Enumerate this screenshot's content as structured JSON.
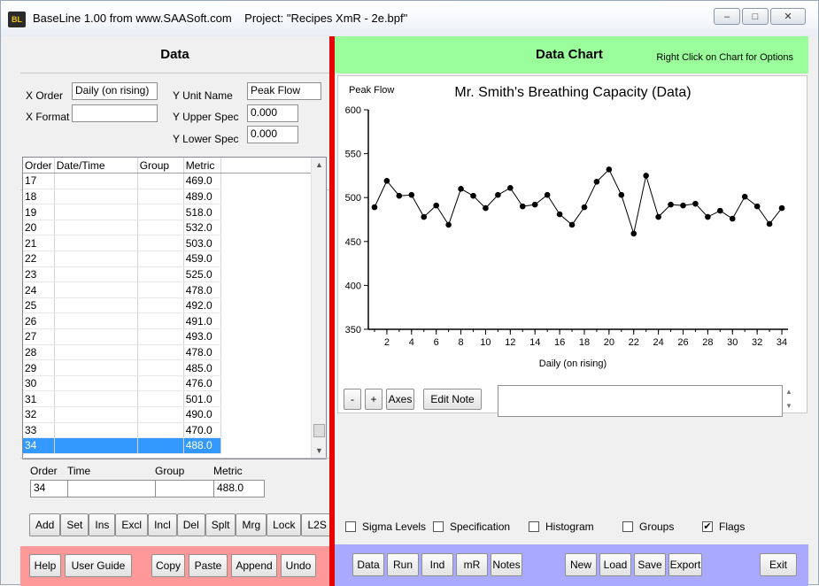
{
  "window": {
    "app_title": "BaseLine 1.00  from www.SAASoft.com",
    "project": "Project: \"Recipes XmR - 2e.bpf\"",
    "app_icon_text": "BL"
  },
  "data_panel": {
    "title": "Data",
    "x_order_label": "X Order",
    "x_order_value": "Daily (on rising)",
    "x_format_label": "X Format",
    "x_format_value": "",
    "y_unit_name_label": "Y Unit Name",
    "y_unit_name_value": "Peak Flow",
    "y_upper_spec_label": "Y Upper Spec",
    "y_upper_spec_value": "0.000",
    "y_lower_spec_label": "Y Lower Spec",
    "y_lower_spec_value": "0.000",
    "columns": [
      "Order",
      "Date/Time",
      "Group",
      "Metric"
    ],
    "rows": [
      {
        "order": "17",
        "metric": "469.0"
      },
      {
        "order": "18",
        "metric": "489.0"
      },
      {
        "order": "19",
        "metric": "518.0"
      },
      {
        "order": "20",
        "metric": "532.0"
      },
      {
        "order": "21",
        "metric": "503.0"
      },
      {
        "order": "22",
        "metric": "459.0"
      },
      {
        "order": "23",
        "metric": "525.0"
      },
      {
        "order": "24",
        "metric": "478.0"
      },
      {
        "order": "25",
        "metric": "492.0"
      },
      {
        "order": "26",
        "metric": "491.0"
      },
      {
        "order": "27",
        "metric": "493.0"
      },
      {
        "order": "28",
        "metric": "478.0"
      },
      {
        "order": "29",
        "metric": "485.0"
      },
      {
        "order": "30",
        "metric": "476.0"
      },
      {
        "order": "31",
        "metric": "501.0"
      },
      {
        "order": "32",
        "metric": "490.0"
      },
      {
        "order": "33",
        "metric": "470.0"
      },
      {
        "order": "34",
        "metric": "488.0"
      }
    ],
    "selected_row": 17,
    "entry": {
      "order_label": "Order",
      "time_label": "Time",
      "group_label": "Group",
      "metric_label": "Metric",
      "order_value": "34",
      "time_value": "",
      "group_value": "",
      "metric_value": "488.0"
    },
    "edit_buttons": [
      "Add",
      "Set",
      "Ins",
      "Excl",
      "Incl",
      "Del",
      "Splt",
      "Mrg",
      "Lock",
      "L2S"
    ],
    "bottom_buttons": [
      "Help",
      "User Guide",
      "Copy",
      "Paste",
      "Append",
      "Undo"
    ]
  },
  "chart_panel": {
    "title": "Data Chart",
    "hint": "Right Click on Chart for Options",
    "note_buttons": [
      "-",
      "+",
      "Axes",
      "Edit Note"
    ],
    "note_text": "",
    "checkboxes": [
      {
        "label": "Sigma Levels",
        "checked": false
      },
      {
        "label": "Specification",
        "checked": false
      },
      {
        "label": "Histogram",
        "checked": false
      },
      {
        "label": "Groups",
        "checked": false
      },
      {
        "label": "Flags",
        "checked": true
      }
    ],
    "bottom_buttons": [
      "Data",
      "Run",
      "Ind",
      "mR",
      "Notes",
      "New",
      "Load",
      "Save",
      "Export",
      "Exit"
    ]
  },
  "colors": {
    "data_panel_footer": "#ff9999",
    "chart_header": "#9aff9a",
    "chart_footer": "#a9a9ff",
    "divider": "#e80000",
    "selected_row": "#3399ff"
  },
  "chart_data": {
    "type": "line",
    "title": "Mr. Smith's Breathing Capacity (Data)",
    "ylabel": "Peak Flow",
    "xlabel": "Daily (on rising)",
    "ylim": [
      350,
      600
    ],
    "yticks": [
      350,
      400,
      450,
      500,
      550,
      600
    ],
    "xticks": [
      2,
      4,
      6,
      8,
      10,
      12,
      14,
      16,
      18,
      20,
      22,
      24,
      26,
      28,
      30,
      32,
      34
    ],
    "x": [
      1,
      2,
      3,
      4,
      5,
      6,
      7,
      8,
      9,
      10,
      11,
      12,
      13,
      14,
      15,
      16,
      17,
      18,
      19,
      20,
      21,
      22,
      23,
      24,
      25,
      26,
      27,
      28,
      29,
      30,
      31,
      32,
      33,
      34
    ],
    "values": [
      489,
      519,
      502,
      503,
      478,
      491,
      469,
      510,
      502,
      488,
      503,
      511,
      490,
      492,
      503,
      481,
      469,
      489,
      518,
      532,
      503,
      459,
      525,
      478,
      492,
      491,
      493,
      478,
      485,
      476,
      501,
      490,
      470,
      488
    ],
    "marker": "circle",
    "grid": false
  }
}
